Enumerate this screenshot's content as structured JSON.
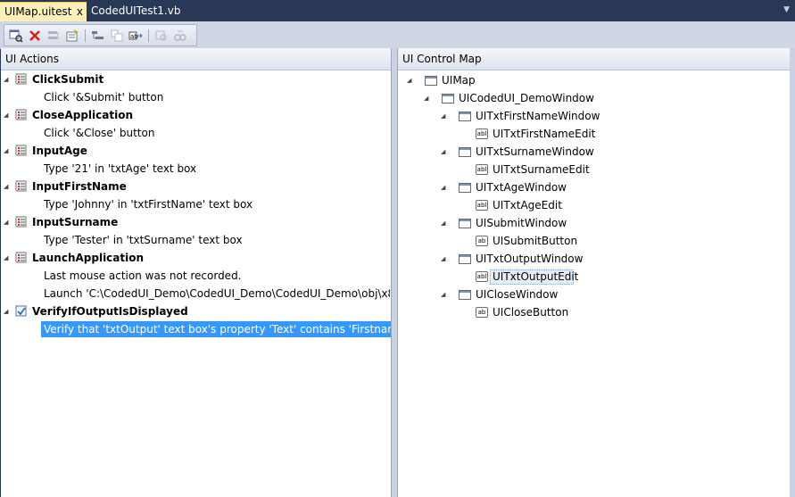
{
  "tabs": [
    {
      "label": "UIMap.uitest",
      "close": "x",
      "active": true
    },
    {
      "label": "CodedUITest1.vb",
      "active": false
    }
  ],
  "left_pane": {
    "title": "UI Actions",
    "items": [
      {
        "method": "ClickSubmit",
        "steps": [
          "Click '&Submit' button"
        ]
      },
      {
        "method": "CloseApplication",
        "steps": [
          "Click '&Close' button"
        ]
      },
      {
        "method": "InputAge",
        "steps": [
          "Type '21' in 'txtAge' text box"
        ]
      },
      {
        "method": "InputFirstName",
        "steps": [
          "Type 'Johnny' in 'txtFirstName' text box"
        ]
      },
      {
        "method": "InputSurname",
        "steps": [
          "Type 'Tester' in 'txtSurname' text box"
        ]
      },
      {
        "method": "LaunchApplication",
        "steps": [
          "Last mouse action was not recorded.",
          "Launch 'C:\\CodedUI_Demo\\CodedUI_Demo\\CodedUI_Demo\\obj\\x86\\Deb"
        ]
      },
      {
        "method": "VerifyIfOutputIsDisplayed",
        "steps": [
          "Verify that 'txtOutput' text box's property 'Text' contains 'Firstname: Johnn"
        ]
      }
    ]
  },
  "right_pane": {
    "title": "UI Control Map",
    "root": "UIMap",
    "window": "UICodedUI_DemoWindow",
    "groups": [
      {
        "window": "UITxtFirstNameWindow",
        "child": "UITxtFirstNameEdit",
        "child_icon": "abl"
      },
      {
        "window": "UITxtSurnameWindow",
        "child": "UITxtSurnameEdit",
        "child_icon": "abl"
      },
      {
        "window": "UITxtAgeWindow",
        "child": "UITxtAgeEdit",
        "child_icon": "abl"
      },
      {
        "window": "UISubmitWindow",
        "child": "UISubmitButton",
        "child_icon": "ab"
      },
      {
        "window": "UITxtOutputWindow",
        "child": "UITxtOutputEdit",
        "child_icon": "abl"
      },
      {
        "window": "UICloseWindow",
        "child": "UICloseButton",
        "child_icon": "ab"
      }
    ]
  },
  "colors": {
    "chrome_dark": "#293955",
    "active_tab": "#fff0b8",
    "selection": "#3399ff"
  }
}
